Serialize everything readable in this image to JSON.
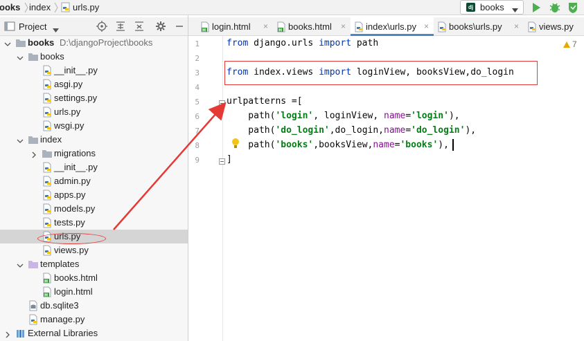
{
  "navbar": {
    "crumb_project": "ooks",
    "crumb_dir": "index",
    "crumb_file": "urls.py",
    "run_config": "books"
  },
  "project_panel": {
    "title": "Project"
  },
  "tree": [
    {
      "label": "books",
      "path": "D:\\djangoProject\\books",
      "bold": true,
      "kind": "folder",
      "depth": 0,
      "expanded": true
    },
    {
      "label": "books",
      "kind": "folder",
      "depth": 1,
      "expanded": true
    },
    {
      "label": "__init__.py",
      "kind": "py",
      "depth": 2
    },
    {
      "label": "asgi.py",
      "kind": "py",
      "depth": 2
    },
    {
      "label": "settings.py",
      "kind": "py",
      "depth": 2
    },
    {
      "label": "urls.py",
      "kind": "py",
      "depth": 2
    },
    {
      "label": "wsgi.py",
      "kind": "py",
      "depth": 2
    },
    {
      "label": "index",
      "kind": "folder",
      "depth": 1,
      "expanded": true
    },
    {
      "label": "migrations",
      "kind": "folder",
      "depth": 2,
      "expanded": false
    },
    {
      "label": "__init__.py",
      "kind": "py",
      "depth": 2
    },
    {
      "label": "admin.py",
      "kind": "py",
      "depth": 2
    },
    {
      "label": "apps.py",
      "kind": "py",
      "depth": 2
    },
    {
      "label": "models.py",
      "kind": "py",
      "depth": 2
    },
    {
      "label": "tests.py",
      "kind": "py",
      "depth": 2
    },
    {
      "label": "urls.py",
      "kind": "py",
      "depth": 2,
      "selected": true
    },
    {
      "label": "views.py",
      "kind": "py",
      "depth": 2
    },
    {
      "label": "templates",
      "kind": "folder-purple",
      "depth": 1,
      "expanded": true
    },
    {
      "label": "books.html",
      "kind": "html",
      "depth": 2
    },
    {
      "label": "login.html",
      "kind": "html",
      "depth": 2
    },
    {
      "label": "db.sqlite3",
      "kind": "db",
      "depth": 1
    },
    {
      "label": "manage.py",
      "kind": "py",
      "depth": 1
    },
    {
      "label": "External Libraries",
      "kind": "lib",
      "depth": 0,
      "expanded": false
    }
  ],
  "tabs": [
    {
      "label": "login.html",
      "kind": "html",
      "active": false,
      "closable": true
    },
    {
      "label": "books.html",
      "kind": "html",
      "active": false,
      "closable": true
    },
    {
      "label": "index\\urls.py",
      "kind": "py",
      "active": true,
      "closable": true
    },
    {
      "label": "books\\urls.py",
      "kind": "py",
      "active": false,
      "closable": true
    },
    {
      "label": "views.py",
      "kind": "py",
      "active": false,
      "closable": false
    }
  ],
  "editor": {
    "warning_count": "7",
    "line_numbers": [
      "1",
      "2",
      "3",
      "4",
      "5",
      "6",
      "7",
      "8",
      "9"
    ],
    "lines": [
      [
        {
          "t": "from",
          "c": "kw"
        },
        {
          "t": " django.urls "
        },
        {
          "t": "import",
          "c": "kw"
        },
        {
          "t": " path"
        }
      ],
      [],
      [
        {
          "t": "from",
          "c": "kw"
        },
        {
          "t": " index.views "
        },
        {
          "t": "import",
          "c": "kw"
        },
        {
          "t": " loginView, booksView,do_login"
        }
      ],
      [],
      [
        {
          "t": "urlpatterns =["
        }
      ],
      [
        {
          "t": "    path("
        },
        {
          "t": "'login'",
          "c": "str"
        },
        {
          "t": ", loginView, "
        },
        {
          "t": "name",
          "c": "kwarg"
        },
        {
          "t": "="
        },
        {
          "t": "'login'",
          "c": "str"
        },
        {
          "t": "),"
        }
      ],
      [
        {
          "t": "    path("
        },
        {
          "t": "'do_login'",
          "c": "str"
        },
        {
          "t": ",do_login,"
        },
        {
          "t": "name",
          "c": "kwarg"
        },
        {
          "t": "="
        },
        {
          "t": "'do_login'",
          "c": "str"
        },
        {
          "t": "),"
        }
      ],
      [
        {
          "t": "    path("
        },
        {
          "t": "'books'",
          "c": "str"
        },
        {
          "t": ",booksView,"
        },
        {
          "t": "name",
          "c": "kwarg"
        },
        {
          "t": "="
        },
        {
          "t": "'books'",
          "c": "str"
        },
        {
          "t": "),"
        }
      ],
      [
        {
          "t": "]"
        }
      ]
    ]
  },
  "colors": {
    "keyword": "#0033b3",
    "string": "#067d17",
    "kwarg": "#871094",
    "annotation": "#e53935",
    "active_tab": "#4a86c8"
  }
}
